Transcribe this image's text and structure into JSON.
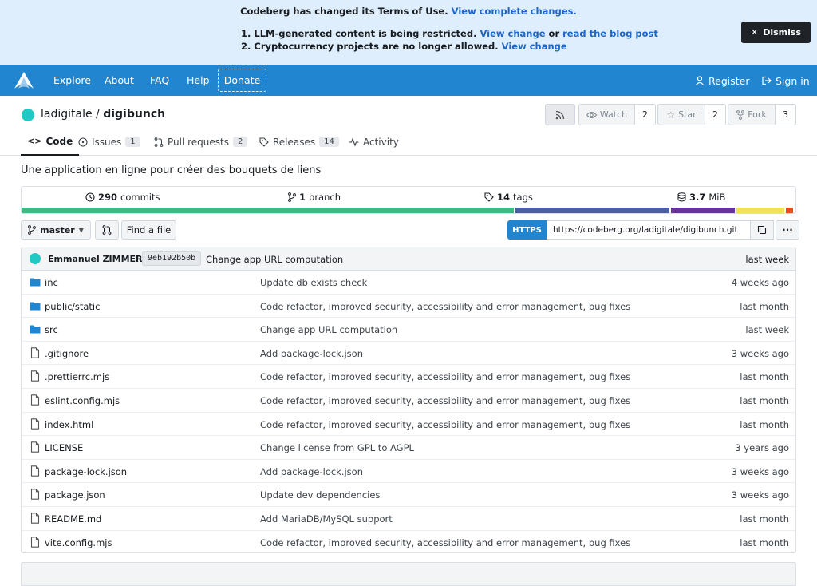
{
  "banner": {
    "line1_text": "Codeberg has changed its Terms of Use.",
    "line1_link": "View complete changes.",
    "item1_text": "1. LLM-generated content is being restricted.",
    "item1_link": "View change",
    "item1_or": "or",
    "item1_link2": "read the blog post",
    "item2_text": "2. Cryptocurrency projects are no longer allowed.",
    "item2_link": "View change",
    "dismiss_label": "Dismiss"
  },
  "navbar": {
    "items": [
      "Explore",
      "About",
      "FAQ",
      "Help"
    ],
    "donate": "Donate",
    "register": "Register",
    "signin": "Sign in"
  },
  "repo": {
    "owner": "ladigitale",
    "separator": "/",
    "name": "digibunch",
    "watch_label": "Watch",
    "watch_count": "2",
    "star_label": "Star",
    "star_count": "2",
    "fork_label": "Fork",
    "fork_count": "3",
    "description": "Une application en ligne pour créer des bouquets de liens"
  },
  "tabs": [
    {
      "label": "Code",
      "badge": ""
    },
    {
      "label": "Issues",
      "badge": "1"
    },
    {
      "label": "Pull requests",
      "badge": "2"
    },
    {
      "label": "Releases",
      "badge": "14"
    },
    {
      "label": "Activity",
      "badge": ""
    }
  ],
  "stats": {
    "commits_num": "290",
    "commits_label": "commits",
    "branch_num": "1",
    "branch_label": "branch",
    "tags_num": "14",
    "tags_label": "tags",
    "size_num": "3.7",
    "size_unit": "MiB"
  },
  "languages": [
    {
      "share": 0.64,
      "color": "#41b883"
    },
    {
      "share": 0.2,
      "color": "#4d5fa3"
    },
    {
      "share": 0.083,
      "color": "#663399"
    },
    {
      "share": 0.063,
      "color": "#f1e05a"
    },
    {
      "share": 0.009,
      "color": "#e34c26"
    }
  ],
  "toolbar": {
    "branch": "master",
    "find_file": "Find a file",
    "clone_protocol": "HTTPS",
    "clone_url": "https://codeberg.org/ladigitale/digibunch.git"
  },
  "latest_commit": {
    "author": "Emmanuel ZIMMERT",
    "sha": "9eb192b50b",
    "message": "Change app URL computation",
    "when": "last week"
  },
  "files": [
    {
      "type": "dir",
      "name": "inc",
      "sub": "",
      "message": "Update db exists check",
      "when": "4 weeks ago"
    },
    {
      "type": "dir",
      "name": "public",
      "sub": "/static",
      "message": "Code refactor, improved security, accessibility and error management, bug fixes",
      "when": "last month"
    },
    {
      "type": "dir",
      "name": "src",
      "sub": "",
      "message": "Change app URL computation",
      "when": "last week"
    },
    {
      "type": "file",
      "name": ".gitignore",
      "sub": "",
      "message": "Add package-lock.json",
      "when": "3 weeks ago"
    },
    {
      "type": "file",
      "name": ".prettierrc.mjs",
      "sub": "",
      "message": "Code refactor, improved security, accessibility and error management, bug fixes",
      "when": "last month"
    },
    {
      "type": "file",
      "name": "eslint.config.mjs",
      "sub": "",
      "message": "Code refactor, improved security, accessibility and error management, bug fixes",
      "when": "last month"
    },
    {
      "type": "file",
      "name": "index.html",
      "sub": "",
      "message": "Code refactor, improved security, accessibility and error management, bug fixes",
      "when": "last month"
    },
    {
      "type": "file",
      "name": "LICENSE",
      "sub": "",
      "message": "Change license from GPL to AGPL",
      "when": "3 years ago"
    },
    {
      "type": "file",
      "name": "package-lock.json",
      "sub": "",
      "message": "Add package-lock.json",
      "when": "3 weeks ago"
    },
    {
      "type": "file",
      "name": "package.json",
      "sub": "",
      "message": "Update dev dependencies",
      "when": "3 weeks ago"
    },
    {
      "type": "file",
      "name": "README.md",
      "sub": "",
      "message": "Add MariaDB/MySQL support",
      "when": "last month"
    },
    {
      "type": "file",
      "name": "vite.config.mjs",
      "sub": "",
      "message": "Code refactor, improved security, accessibility and error management, bug fixes",
      "when": "last month"
    }
  ]
}
